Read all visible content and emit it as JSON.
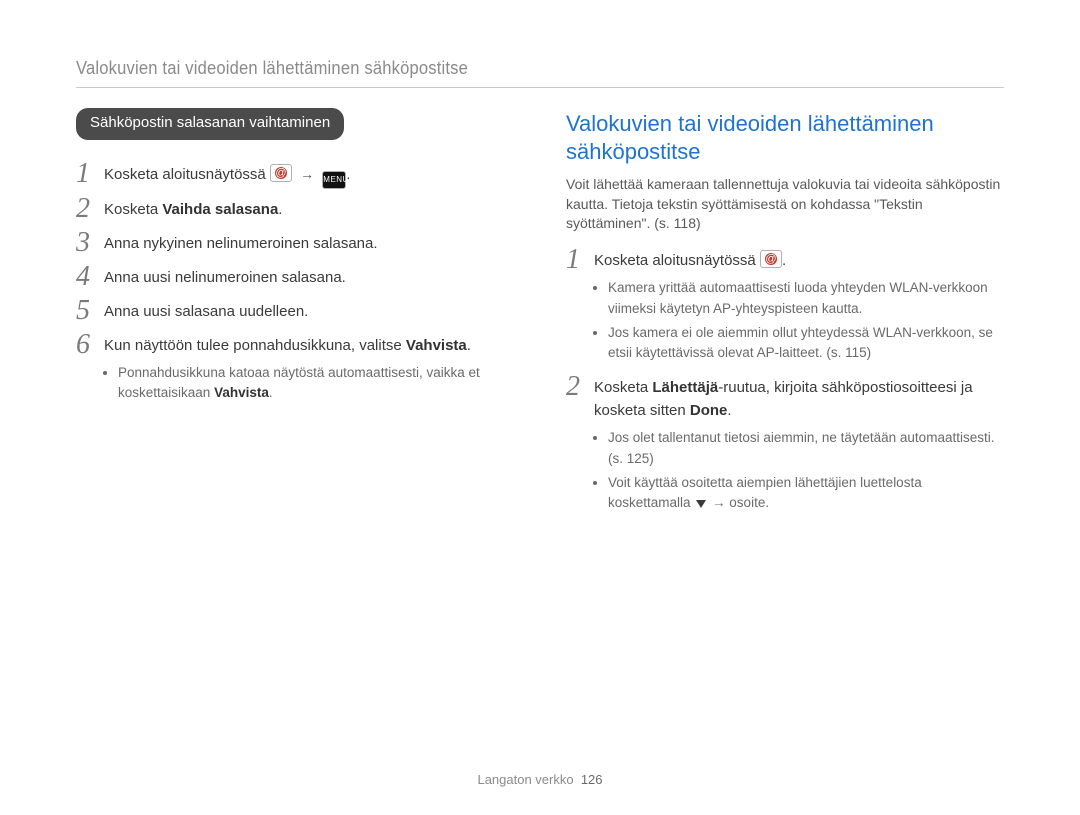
{
  "header": {
    "title": "Valokuvien tai videoiden lähettäminen sähköpostitse"
  },
  "left": {
    "pill": "Sähköpostin salasanan vaihtaminen",
    "steps": [
      {
        "num": "1",
        "text_before": "Kosketa aloitusnäytössä ",
        "icons": "both",
        "text_after": "."
      },
      {
        "num": "2",
        "text_before": "Kosketa ",
        "bold": "Vaihda salasana",
        "text_after": "."
      },
      {
        "num": "3",
        "text_before": "Anna nykyinen nelinumeroinen salasana."
      },
      {
        "num": "4",
        "text_before": "Anna uusi nelinumeroinen salasana."
      },
      {
        "num": "5",
        "text_before": "Anna uusi salasana uudelleen."
      },
      {
        "num": "6",
        "text_before": "Kun näyttöön tulee ponnahdusikkuna, valitse ",
        "bold": "Vahvista",
        "text_after": ".",
        "bullets": [
          "Ponnahdusikkuna katoaa näytöstä automaattisesti, vaikka et koskettaisikaan <b>Vahvista</b>."
        ]
      }
    ]
  },
  "right": {
    "title": "Valokuvien tai videoiden lähettäminen sähköpostitse",
    "intro": "Voit lähettää kameraan tallennettuja valokuvia tai videoita sähköpostin kautta. Tietoja tekstin syöttämisestä on kohdassa \"Tekstin syöttäminen\". (s. 118)",
    "steps": [
      {
        "num": "1",
        "text_before": "Kosketa aloitusnäytössä ",
        "icons": "badge",
        "text_after": ".",
        "bullets": [
          "Kamera yrittää automaattisesti luoda yhteyden WLAN-verkkoon viimeksi käytetyn AP-yhteyspisteen kautta.",
          "Jos kamera ei ole aiemmin ollut yhteydessä WLAN-verkkoon, se etsii käytettävissä olevat AP-laitteet. (s. 115)"
        ]
      },
      {
        "num": "2",
        "text_before": "Kosketa ",
        "bold": "Lähettäjä",
        "text_mid": "-ruutua, kirjoita sähköpostiosoitteesi ja kosketa sitten ",
        "bold2": "Done",
        "text_after": ".",
        "bullets": [
          "Jos olet tallentanut tietosi aiemmin, ne täytetään automaattisesti. (s. 125)",
          "Voit käyttää osoitetta aiempien lähettäjien luettelosta koskettamalla <tri> → osoite."
        ]
      }
    ]
  },
  "footer": {
    "section": "Langaton verkko",
    "page": "126"
  }
}
